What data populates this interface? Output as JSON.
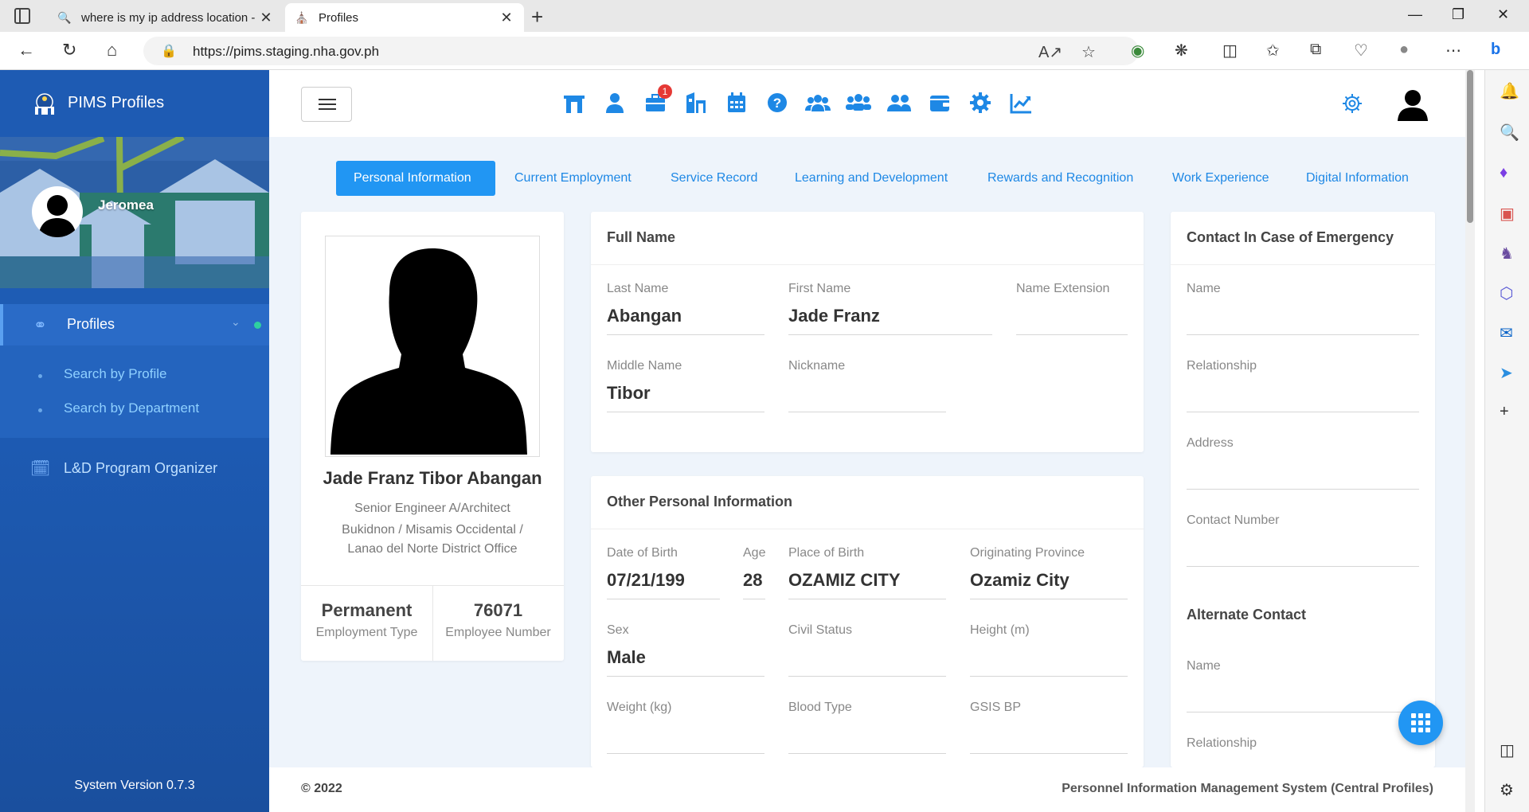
{
  "browser": {
    "tabs": [
      {
        "title": "where is my ip address location -",
        "icon": "search-icon"
      },
      {
        "title": "Profiles",
        "icon": "nha-logo-icon"
      }
    ],
    "url": "https://pims.staging.nha.gov.ph"
  },
  "sidebar": {
    "brand": "PIMS Profiles",
    "user_name": "Jeromea",
    "menu": {
      "profiles_label": "Profiles",
      "sub_items": [
        "Search by Profile",
        "Search by Department"
      ],
      "ld_label": "L&D Program Organizer"
    },
    "version": "System Version 0.7.3"
  },
  "topnav": {
    "icons": [
      "building-icon",
      "user-icon",
      "briefcase-icon",
      "city-icon",
      "calendar-icon",
      "question-icon",
      "users-icon",
      "users-group-icon",
      "user-friends-icon",
      "wallet-icon",
      "cog-icon",
      "chart-line-icon"
    ],
    "briefcase_badge": "1"
  },
  "profile_tabs": [
    "Personal Information",
    "Current Employment",
    "Service Record",
    "Learning and Development",
    "Rewards and Recognition",
    "Work Experience",
    "Digital Information"
  ],
  "profile": {
    "name": "Jade Franz Tibor Abangan",
    "position": "Senior Engineer A/Architect",
    "office_line1": "Bukidnon / Misamis Occidental /",
    "office_line2": "Lanao del Norte District Office",
    "employment_type": "Permanent",
    "employment_type_label": "Employment Type",
    "employee_number": "76071",
    "employee_number_label": "Employee Number"
  },
  "full_name": {
    "title": "Full Name",
    "last_name_label": "Last Name",
    "last_name": "Abangan",
    "first_name_label": "First Name",
    "first_name": "Jade Franz",
    "name_ext_label": "Name Extension",
    "name_ext": "",
    "middle_name_label": "Middle Name",
    "middle_name": "Tibor",
    "nickname_label": "Nickname",
    "nickname": ""
  },
  "other_info": {
    "title": "Other Personal Information",
    "dob_label": "Date of Birth",
    "dob": "07/21/199",
    "age_label": "Age",
    "age": "28",
    "pob_label": "Place of Birth",
    "pob": "OZAMIZ CITY",
    "province_label": "Originating Province",
    "province": "Ozamiz City",
    "sex_label": "Sex",
    "sex": "Male",
    "civil_label": "Civil Status",
    "civil": "",
    "height_label": "Height (m)",
    "height": "",
    "weight_label": "Weight (kg)",
    "weight": "",
    "blood_label": "Blood Type",
    "blood": "",
    "gsis_label": "GSIS BP",
    "gsis": ""
  },
  "emergency": {
    "title": "Contact In Case of Emergency",
    "name_label": "Name",
    "relationship_label": "Relationship",
    "address_label": "Address",
    "contact_label": "Contact Number",
    "alt_title": "Alternate Contact",
    "alt_name_label": "Name",
    "alt_relationship_label": "Relationship"
  },
  "footer": {
    "copyright": "© 2022",
    "system": "Personnel Information Management System (Central Profiles)"
  }
}
